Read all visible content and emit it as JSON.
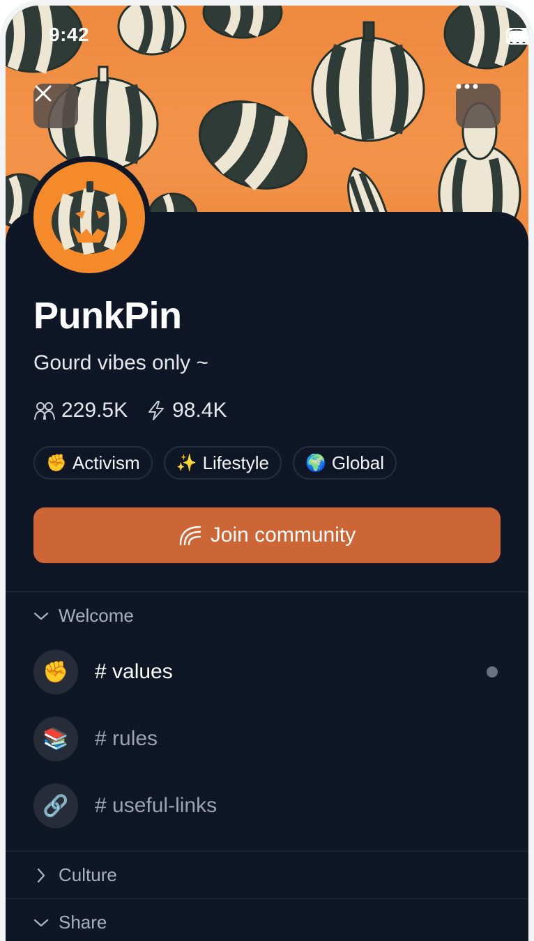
{
  "status_bar": {
    "time": "9:42"
  },
  "header": {
    "close_icon": "close-icon",
    "more_icon": "more-horizontal-icon"
  },
  "community": {
    "name": "PunkPin",
    "tagline": "Gourd vibes only ~",
    "members": "229.5K",
    "activity": "98.4K"
  },
  "tags": [
    {
      "emoji": "✊",
      "label": "Activism"
    },
    {
      "emoji": "✨",
      "label": "Lifestyle"
    },
    {
      "emoji": "🌍",
      "label": "Global"
    }
  ],
  "join_button": {
    "label": "Join community",
    "icon": "rainbow-icon",
    "color": "#cd6636"
  },
  "sections": [
    {
      "title": "Welcome",
      "expanded": true,
      "channels": [
        {
          "emoji": "✊",
          "label": "# values",
          "unread": true
        },
        {
          "emoji": "📚",
          "label": "# rules",
          "unread": false
        },
        {
          "emoji": "🔗",
          "label": "# useful-links",
          "unread": false
        }
      ]
    },
    {
      "title": "Culture",
      "expanded": false
    },
    {
      "title": "Share",
      "expanded": true
    }
  ],
  "colors": {
    "banner": "#ef8a40",
    "background": "#0f1726",
    "avatar": "#f58a2b",
    "accent": "#cd6636"
  }
}
